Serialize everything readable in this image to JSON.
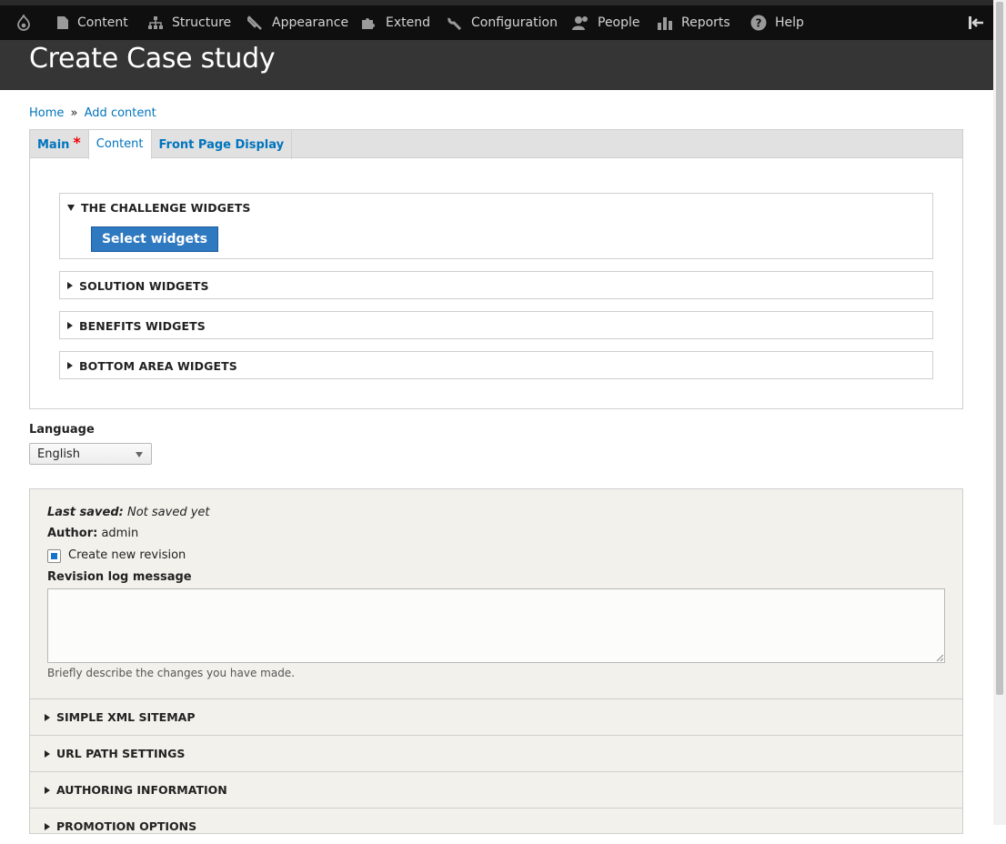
{
  "toolbar": {
    "items": [
      {
        "label": "Content",
        "icon": "document-icon"
      },
      {
        "label": "Structure",
        "icon": "sitemap-icon"
      },
      {
        "label": "Appearance",
        "icon": "paintbrush-icon"
      },
      {
        "label": "Extend",
        "icon": "puzzle-icon"
      },
      {
        "label": "Configuration",
        "icon": "wrench-icon"
      },
      {
        "label": "People",
        "icon": "people-icon"
      },
      {
        "label": "Reports",
        "icon": "bar-chart-icon"
      },
      {
        "label": "Help",
        "icon": "question-icon"
      }
    ]
  },
  "page": {
    "title": "Create Case study"
  },
  "breadcrumb": {
    "home": "Home",
    "sep": "»",
    "add_content": "Add content"
  },
  "tabs": [
    {
      "label": "Main",
      "required_mark": "*"
    },
    {
      "label": "Content"
    },
    {
      "label": "Front Page Display"
    }
  ],
  "widgets": {
    "challenge": "THE CHALLENGE WIDGETS",
    "select_button": "Select widgets",
    "solution": "SOLUTION WIDGETS",
    "benefits": "BENEFITS WIDGETS",
    "bottom": "BOTTOM AREA WIDGETS"
  },
  "language": {
    "label": "Language",
    "value": "English"
  },
  "meta": {
    "last_saved_label": "Last saved:",
    "last_saved_value": "Not saved yet",
    "author_label": "Author:",
    "author_value": "admin",
    "revision_checkbox": "Create new revision",
    "log_label": "Revision log message",
    "log_value": "",
    "log_desc": "Briefly describe the changes you have made."
  },
  "sections": {
    "sitemap": "SIMPLE XML SITEMAP",
    "url": "URL PATH SETTINGS",
    "authoring": "AUTHORING INFORMATION",
    "promotion": "PROMOTION OPTIONS"
  },
  "colors": {
    "toolbar": "#0f0f0f",
    "header": "#353535",
    "link": "#0074bd",
    "button": "#2f79c0"
  }
}
